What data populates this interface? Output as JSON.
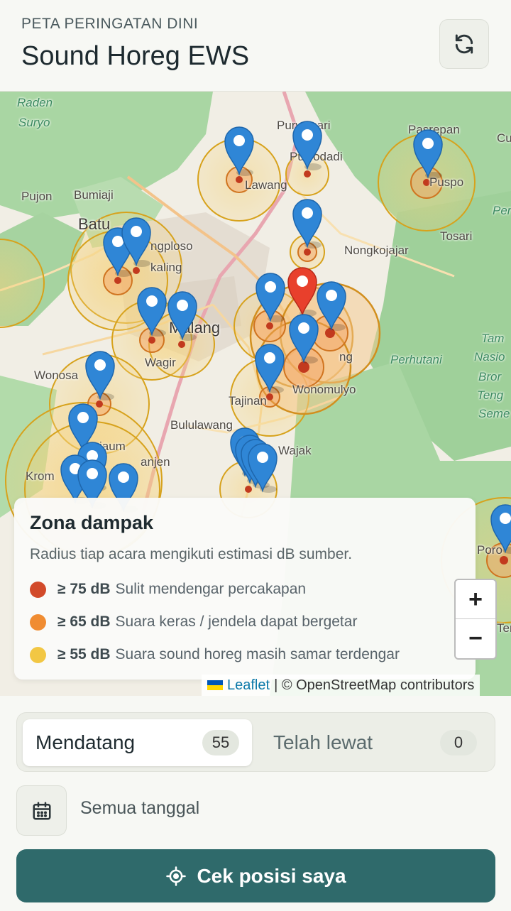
{
  "header": {
    "eyebrow": "PETA PERINGATAN DINI",
    "title": "Sound Horeg EWS",
    "refresh_icon": "refresh-icon"
  },
  "map": {
    "places": {
      "raden_surya": "Raden\nSurya",
      "raden": "Raden",
      "surya": "Suryo",
      "purwosari": "Purwosari",
      "purwodadi": "Puwodadi",
      "lawang": "Lawang",
      "pasrepan": "Pasrepan",
      "puspo": "Puspo",
      "pujon": "Pujon",
      "bumiaji": "Bumiaji",
      "batu": "Batu",
      "singosari": "ngploso",
      "karangploso": "kaling",
      "tosari": "Tosari",
      "nongkojajar": "Nongkojajar",
      "malang": "Malang",
      "wagir": "Wagir",
      "wonosari": "Wonosa",
      "tumpang": "ng",
      "wonomulyo": "Wonomulyo",
      "tajinan": "Tajinan",
      "perhutani": "Perhutani",
      "bululawang": "Bululawang",
      "wajak": "Wajak",
      "kromengan": "Krom",
      "kanjen": "anjen",
      "pagak": "jaum",
      "taman": "Tam",
      "nasional": "Nasio",
      "bromo": "Bror",
      "tengger": "Teng",
      "semeru": "Seme",
      "per": "Per",
      "cu": "Cu",
      "poron": "Poro",
      "ter": "Ter"
    },
    "legend": {
      "title": "Zona dampak",
      "description": "Radius tiap acara mengikuti estimasi dB sumber.",
      "rows": [
        {
          "db": "≥ 75 dB",
          "text": "Sulit mendengar percakapan",
          "color": "#d24a2a"
        },
        {
          "db": "≥ 65 dB",
          "text": "Suara keras / jendela dapat bergetar",
          "color": "#f08c32"
        },
        {
          "db": "≥ 55 dB",
          "text": "Suara sound horeg masih samar terdengar",
          "color": "#f2c744"
        }
      ]
    },
    "zoom_in": "+",
    "zoom_out": "−",
    "attribution": {
      "leaflet": "Leaflet",
      "rest": "| © OpenStreetMap contributors"
    }
  },
  "tabs": [
    {
      "label": "Mendatang",
      "count": "55",
      "active": true
    },
    {
      "label": "Telah lewat",
      "count": "0",
      "active": false
    }
  ],
  "date_filter": {
    "icon": "calendar-icon",
    "label": "Semua tanggal"
  },
  "cta": {
    "icon": "locate-icon",
    "label": "Cek posisi saya",
    "color": "#2f6a6b"
  }
}
